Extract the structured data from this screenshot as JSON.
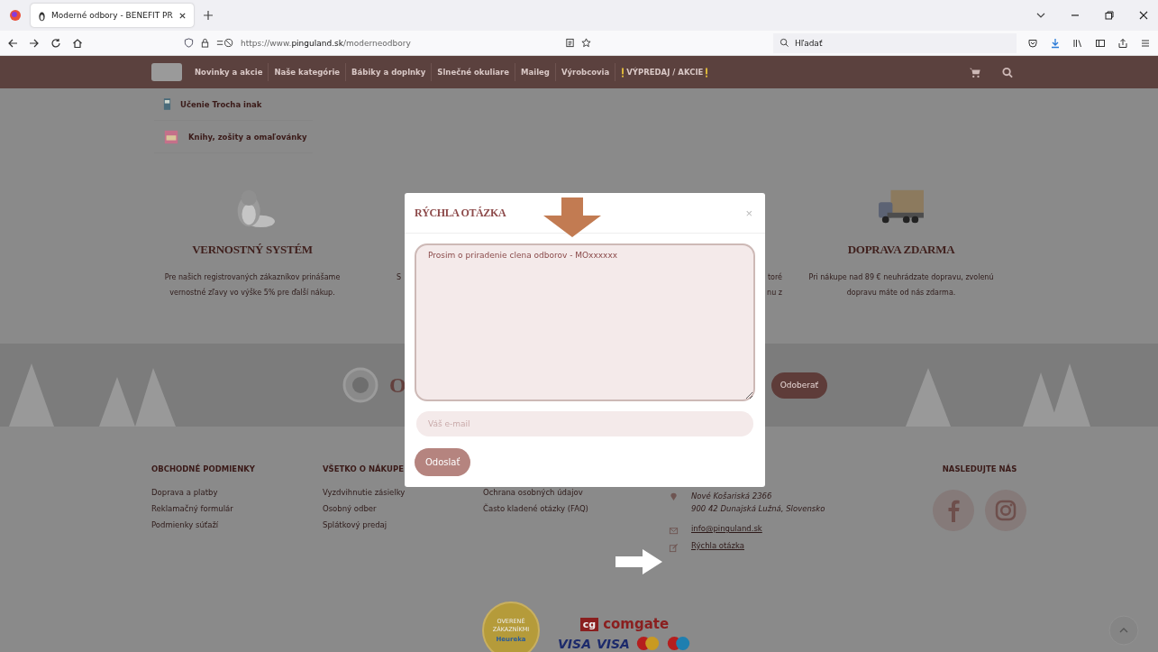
{
  "browser": {
    "tab_title": "Moderné odbory - BENEFIT PR",
    "url_scheme": "https://www.",
    "url_domain": "pinguland.sk",
    "url_path": "/moderneodbory",
    "search_placeholder": "Hľadať"
  },
  "nav": {
    "items": [
      {
        "label": "Novinky a akcie",
        "kind": "link"
      },
      {
        "label": "Naše kategórie",
        "kind": "link"
      },
      {
        "label": "Bábiky a doplnky",
        "kind": "link"
      },
      {
        "label": "Slnečné okuliare",
        "kind": "link"
      },
      {
        "label": "Maileg",
        "kind": "link"
      },
      {
        "label": "Výrobcovia",
        "kind": "link"
      },
      {
        "label": "VÝPREDAJ / AKCIE",
        "kind": "sale"
      }
    ]
  },
  "menu": {
    "items": [
      {
        "label": "Učenie Trocha inak"
      },
      {
        "label": "Knihy, zošity a omaľovánky"
      }
    ]
  },
  "features": [
    {
      "kind": "feature",
      "title": "VERNOSTNÝ SYSTÉM",
      "text": "Pre našich registrovaných zákazníkov prinášame vernostné zľavy vo výške 5% pre ďalší nákup."
    },
    {
      "kind": "cut_right",
      "lines": [
        "S"
      ]
    },
    {
      "kind": "cut_left",
      "lines": [
        "toré",
        "nu z"
      ]
    },
    {
      "kind": "feature",
      "title": "DOPRAVA ZDARMA",
      "text": "Pri nákupe nad 89 € neuhrádzate dopravu, zvolenú dopravu máte od nás zdarma."
    }
  ],
  "newsletter": {
    "heading": "O",
    "button": "Odoberať"
  },
  "footer": {
    "columns": [
      {
        "heading": "OBCHODNÉ PODMIENKY",
        "links": [
          "Doprava a platby",
          "Reklamačný formulár",
          "Podmienky súťaží"
        ]
      },
      {
        "heading": "VŠETKO O NÁKUPE",
        "links": [
          "Vyzdvihnutie zásielky",
          "Osobný odber",
          "Splátkový predaj"
        ]
      },
      {
        "links": [
          "Ochrana osobných údajov",
          "Často kladené otázky (FAQ)"
        ]
      }
    ],
    "contact": {
      "address": [
        "Nové Košariská 2366",
        "900 42 Dunajská Lužná, Slovensko"
      ],
      "email": "info@pinguland.sk",
      "question": "Rýchla otázka"
    },
    "follow": {
      "heading": "NASLEDUJTE NÁS"
    }
  },
  "payments": {
    "badge_lines": [
      "OVERENÉ",
      "ZÁKAZNÍKMI"
    ],
    "badge_brand": "Heureka",
    "comgate_mark": "cg",
    "comgate_name": "comgate",
    "cards": [
      {
        "kind": "visa",
        "label": "VISA"
      },
      {
        "kind": "visa",
        "label": "VISA"
      },
      {
        "kind": "mastercard"
      },
      {
        "kind": "maestro"
      }
    ]
  },
  "modal": {
    "title": "RÝCHLA OTÁZKA",
    "close": "×",
    "message": "Prosim o priradenie clena odborov - MOxxxxxx",
    "email_placeholder": "Váš e-mail",
    "submit": "Odoslať"
  }
}
